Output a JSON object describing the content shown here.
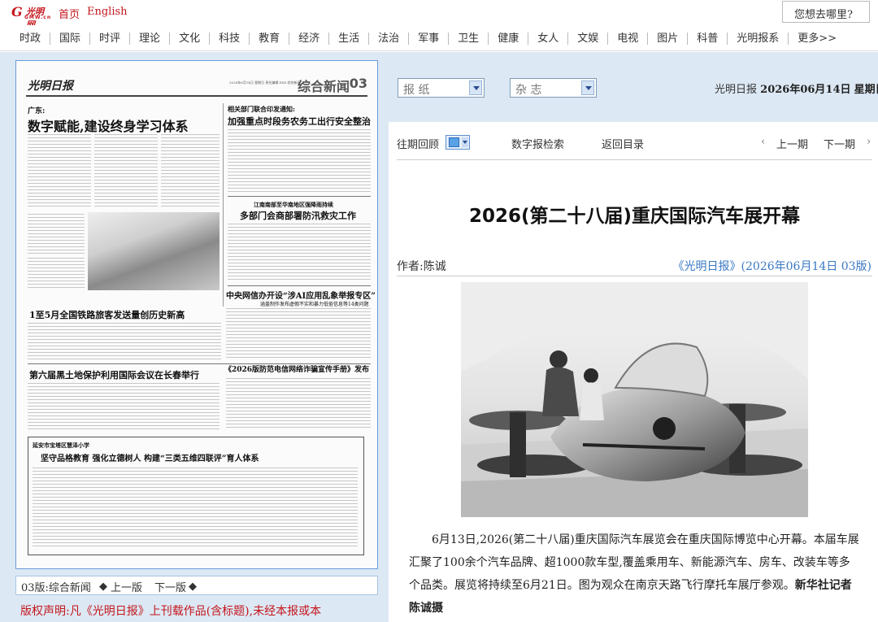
{
  "header": {
    "logo_text": "光明网",
    "logo_sub": "GMW.cn",
    "links": [
      "首页",
      "English"
    ],
    "search_placeholder": "您想去哪里?"
  },
  "nav": {
    "items": [
      "时政",
      "国际",
      "时评",
      "理论",
      "文化",
      "科技",
      "教育",
      "经济",
      "生活",
      "法治",
      "军事",
      "卫生",
      "健康",
      "女人",
      "文娱",
      "电视",
      "图片",
      "科普",
      "光明报系",
      "更多>>"
    ]
  },
  "paper": {
    "masthead_logo": "光明日报",
    "section_title": "综合新闻",
    "page_no": "03",
    "masthead_date": "2026年6月14日 星期日 责任编辑:XXX 综合新闻",
    "headlines": {
      "h1_pre": "广东:",
      "h1": "数字赋能,建设终身学习体系",
      "h2_pre": "相关部门联合印发通知:",
      "h2": "加强重点时段务农务工出行安全整治",
      "h3_pre": "江南南部至华南地区强降雨持续",
      "h3": "多部门会商部署防汛救灾工作",
      "h4": "中央网信办开设“涉AI应用乱象举报专区”",
      "h4_sub": "涵盖制作发布虚假不实和暴力低俗信息等14类问题",
      "h5": "1至5月全国铁路旅客发送量创历史新高",
      "h6": "第六届黑土地保护利用国际会议在长春举行",
      "h7": "《2026版防范电信网络诈骗宣传手册》发布",
      "h8_pre": "延安市宝塔区慧泽小学",
      "h8": "坚守品格教育  强化立德树人  构建“三类五维四联评”育人体系"
    }
  },
  "page_nav": {
    "current": "03版:综合新闻",
    "prev": "上一版",
    "next": "下一版"
  },
  "copyright": "版权声明:凡《光明日报》上刊载作品(含标题),未经本报或本",
  "right": {
    "select_paper": "报 纸",
    "select_magazine": "杂 志",
    "date_prefix": "光明日报",
    "date": "2026年06月14日",
    "weekday": "星期日",
    "tools": {
      "history": "往期回顾",
      "search": "数字报检索",
      "toc": "返回目录",
      "prev": "上一期",
      "next": "下一期"
    },
    "article": {
      "title": "2026(第二十八届)重庆国际汽车展开幕",
      "author": "作者:陈诚",
      "source": "《光明日报》(2026年06月14日 03版)",
      "caption": "6月13日,2026(第二十八届)重庆国际汽车展览会在重庆国际博览中心开幕。本届车展汇聚了100余个汽车品牌、超1000款车型,覆盖乘用车、新能源汽车、房车、改装车等多个品类。展览将持续至6月21日。图为观众在南京天路飞行摩托车展厅参观。",
      "caption_credit": "新华社记者 陈诚摄"
    }
  }
}
